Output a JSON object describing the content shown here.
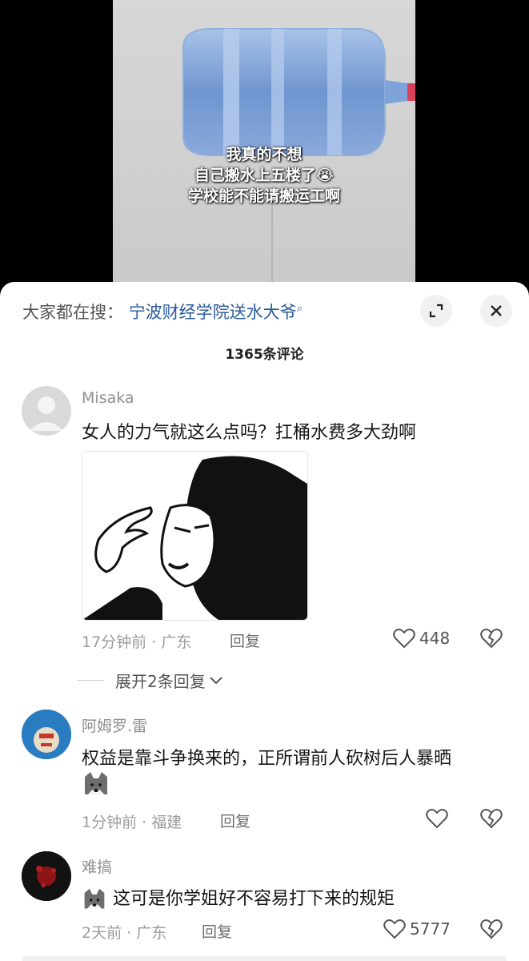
{
  "video": {
    "caption_lines": [
      "我真的不想",
      "自己搬水上五楼了😭",
      "学校能不能请搬运工啊"
    ]
  },
  "search": {
    "prefix": "大家都在搜：",
    "query": "宁波财经学院送水大爷"
  },
  "comments_header": {
    "count_label": "1365条评论"
  },
  "comments": [
    {
      "username": "Misaka",
      "text": "女人的力气就这么点吗？扛桶水费多大劲啊",
      "time": "17分钟前",
      "separator": "·",
      "location": "广东",
      "reply_label": "回复",
      "likes": "448",
      "expand_label": "展开2条回复"
    },
    {
      "username": "阿姆罗.雷",
      "text": "权益是靠斗争换来的，正所谓前人砍树后人暴晒",
      "time": "1分钟前",
      "separator": "·",
      "location": "福建",
      "reply_label": "回复",
      "likes": ""
    },
    {
      "username": "难搞",
      "text": "这可是你学姐好不容易打下来的规矩",
      "time": "2天前",
      "separator": "·",
      "location": "广东",
      "reply_label": "回复",
      "likes": "5777"
    }
  ],
  "icons": {
    "expand": "expand-icon",
    "close": "close-icon",
    "like": "heart-icon",
    "dislike": "broken-heart-icon",
    "chevron": "chevron-down-icon"
  },
  "colors": {
    "link": "#2a5b9c",
    "panel": "#ffffff"
  }
}
